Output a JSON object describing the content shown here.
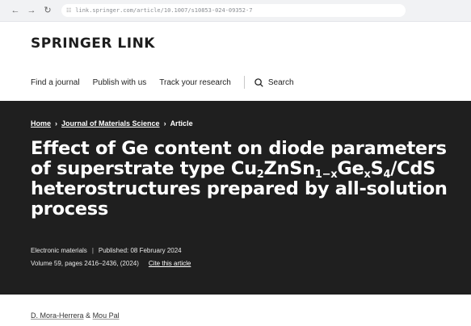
{
  "browser": {
    "url": "link.springer.com/article/10.1007/s10853-024-09352-7",
    "back_icon": "arrow-left-icon",
    "forward_icon": "arrow-right-icon",
    "reload_icon": "reload-icon"
  },
  "site": {
    "logo": "SPRINGER LINK",
    "nav": {
      "find_journal": "Find a journal",
      "publish": "Publish with us",
      "track": "Track your research",
      "search": "Search"
    }
  },
  "breadcrumb": {
    "home": "Home",
    "journal": "Journal of Materials Science",
    "current": "Article"
  },
  "article": {
    "title_part1": "Effect of Ge content on diode parameters of superstrate type Cu",
    "sub_2": "2",
    "title_part2": "ZnSn",
    "sub_1x": "1−x",
    "title_part3": "Ge",
    "sub_x": "x",
    "title_part4": "S",
    "sub_4": "4",
    "title_part5": "/CdS heterostructures prepared by all-solution process",
    "section": "Electronic materials",
    "published": "Published: 08 February 2024",
    "volume": "Volume 59, pages 2416–2436, (2024)",
    "cite": "Cite this article",
    "authors": {
      "author1": "D. Mora-Herrera",
      "amp": "&",
      "author2": "Mou Pal"
    }
  },
  "colors": {
    "hero_bg": "#1f1f1f",
    "text_dark": "#1d1d1d"
  }
}
